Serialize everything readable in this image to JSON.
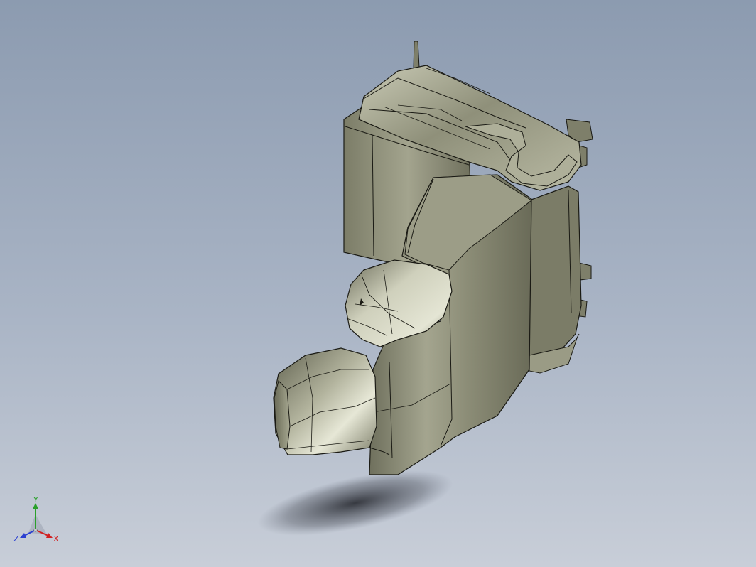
{
  "viewport": {
    "background_top": "#8c9bb0",
    "background_bottom": "#c8ced8",
    "model_color": "#8a8b74",
    "model_highlight": "#d8d9c6",
    "edge_color": "#1a1a14"
  },
  "triad": {
    "x_label": "X",
    "y_label": "Y",
    "z_label": "Z",
    "x_color": "#d12020",
    "y_color": "#2aa02a",
    "z_color": "#2a3fd1"
  }
}
